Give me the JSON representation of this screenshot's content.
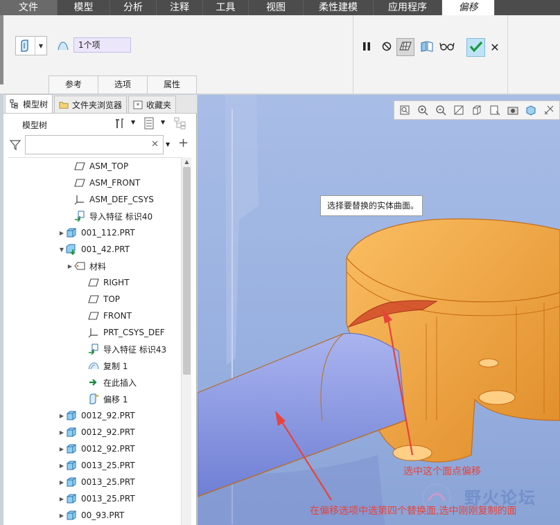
{
  "ribbon_tabs": [
    "文件",
    "模型",
    "分析",
    "注释",
    "工具",
    "视图",
    "柔性建模",
    "应用程序",
    "偏移"
  ],
  "reference_field": {
    "value": "1个项"
  },
  "sub_tabs": [
    "参考",
    "选项",
    "属性"
  ],
  "panel_tabs": [
    "模型树",
    "文件夹浏览器",
    "收藏夹"
  ],
  "tree_header": "模型树",
  "filter": {
    "value": ""
  },
  "tree": [
    {
      "label": "ASM_TOP",
      "icon": "datum-plane-icon",
      "expand": ""
    },
    {
      "label": "ASM_FRONT",
      "icon": "datum-plane-icon",
      "expand": ""
    },
    {
      "label": "ASM_DEF_CSYS",
      "icon": "coordinate-system-icon",
      "expand": ""
    },
    {
      "label": "导入特征 标识40",
      "icon": "import-feature-icon",
      "expand": ""
    },
    {
      "label": "001_112.PRT",
      "icon": "part-icon",
      "expand": "▶"
    },
    {
      "label": "001_42.PRT",
      "icon": "active-part-icon",
      "expand": "▼"
    },
    {
      "label": "材料",
      "icon": "material-icon",
      "expand": "▶"
    },
    {
      "label": "RIGHT",
      "icon": "datum-plane-icon",
      "expand": ""
    },
    {
      "label": "TOP",
      "icon": "datum-plane-icon",
      "expand": ""
    },
    {
      "label": "FRONT",
      "icon": "datum-plane-icon",
      "expand": ""
    },
    {
      "label": "PRT_CSYS_DEF",
      "icon": "coordinate-system-icon",
      "expand": ""
    },
    {
      "label": "导入特征 标识43",
      "icon": "import-feature-icon",
      "expand": ""
    },
    {
      "label": "复制 1",
      "icon": "copy-surface-icon",
      "expand": ""
    },
    {
      "label": "在此插入",
      "icon": "insert-here-arrow-icon",
      "expand": ""
    },
    {
      "label": "偏移 1",
      "icon": "offset-feature-icon",
      "expand": ""
    },
    {
      "label": "0012_92.PRT",
      "icon": "part-icon",
      "expand": "▶"
    },
    {
      "label": "0012_92.PRT",
      "icon": "part-icon",
      "expand": "▶"
    },
    {
      "label": "0012_92.PRT",
      "icon": "part-icon",
      "expand": "▶"
    },
    {
      "label": "0013_25.PRT",
      "icon": "part-icon",
      "expand": "▶"
    },
    {
      "label": "0013_25.PRT",
      "icon": "part-icon",
      "expand": "▶"
    },
    {
      "label": "0013_25.PRT",
      "icon": "part-icon",
      "expand": "▶"
    },
    {
      "label": "00_93.PRT",
      "icon": "part-icon",
      "expand": "▶"
    }
  ],
  "viewport": {
    "tooltip": "选择要替换的实体曲面。",
    "annotation_1": "选中这个面点偏移",
    "annotation_2": "在偏移选项中选第四个替换面,选中刚刚复制的面",
    "watermark": "野火论坛"
  },
  "colors": {
    "annotation": "#e8433a",
    "part_orange": "#f39a2e",
    "cylinder_blue": "#8b9fe6",
    "background": "#98b0e0"
  }
}
